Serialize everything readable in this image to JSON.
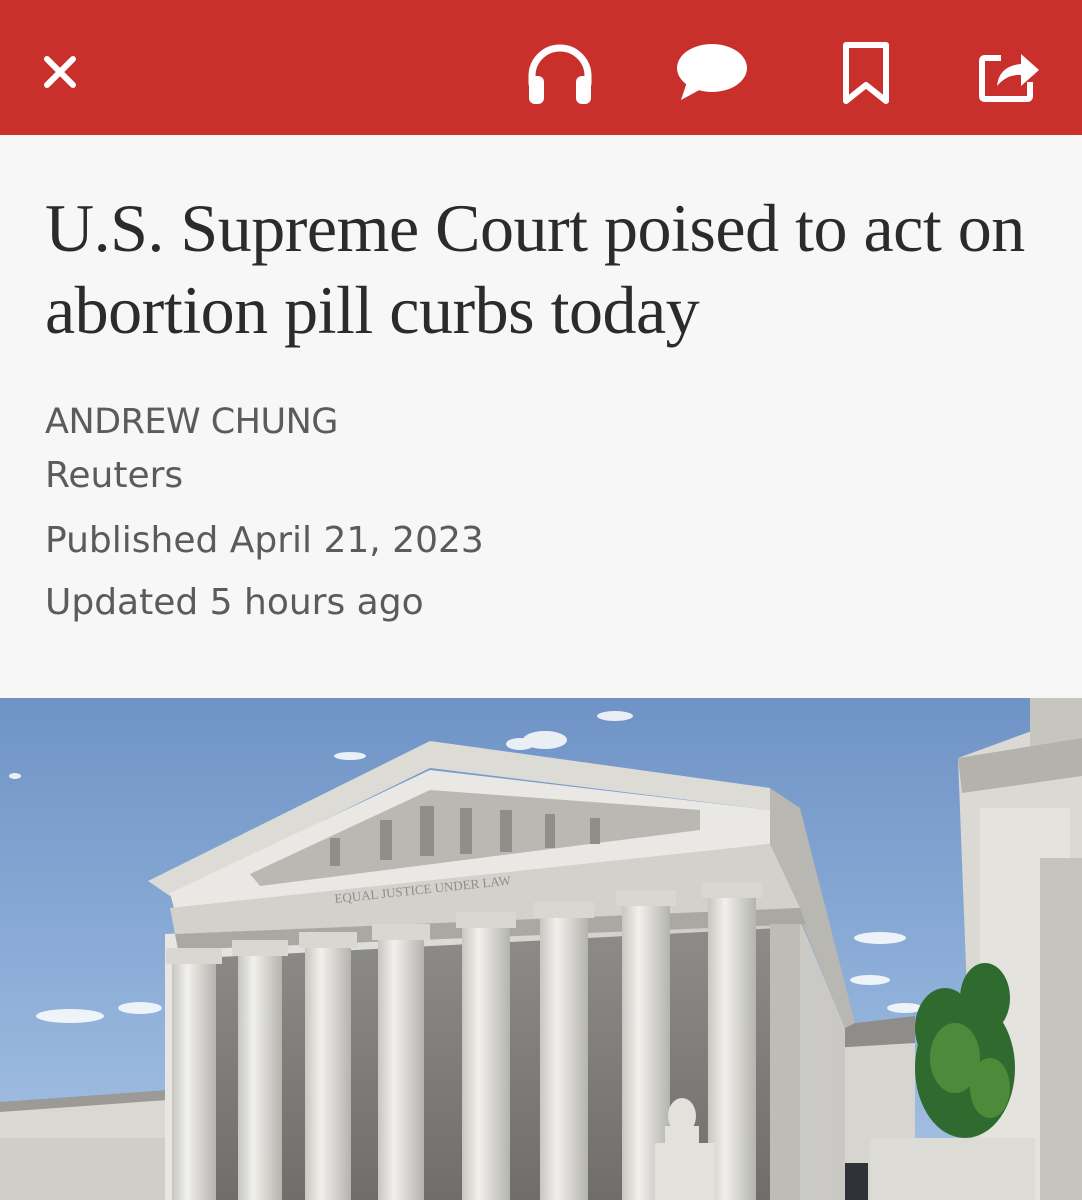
{
  "toolbar": {
    "background": "#c9302c",
    "icons": {
      "close": "close-icon",
      "listen": "headphones-icon",
      "comments": "comment-icon",
      "save": "bookmark-icon",
      "share": "share-icon"
    }
  },
  "article": {
    "headline": "U.S. Supreme Court poised to act on abortion pill curbs today",
    "author": "ANDREW CHUNG",
    "source": "Reuters",
    "published": "Published April 21, 2023",
    "updated": "Updated 5 hours ago"
  },
  "photo": {
    "frieze_text": "EQUAL JUSTICE UNDER LAW"
  }
}
